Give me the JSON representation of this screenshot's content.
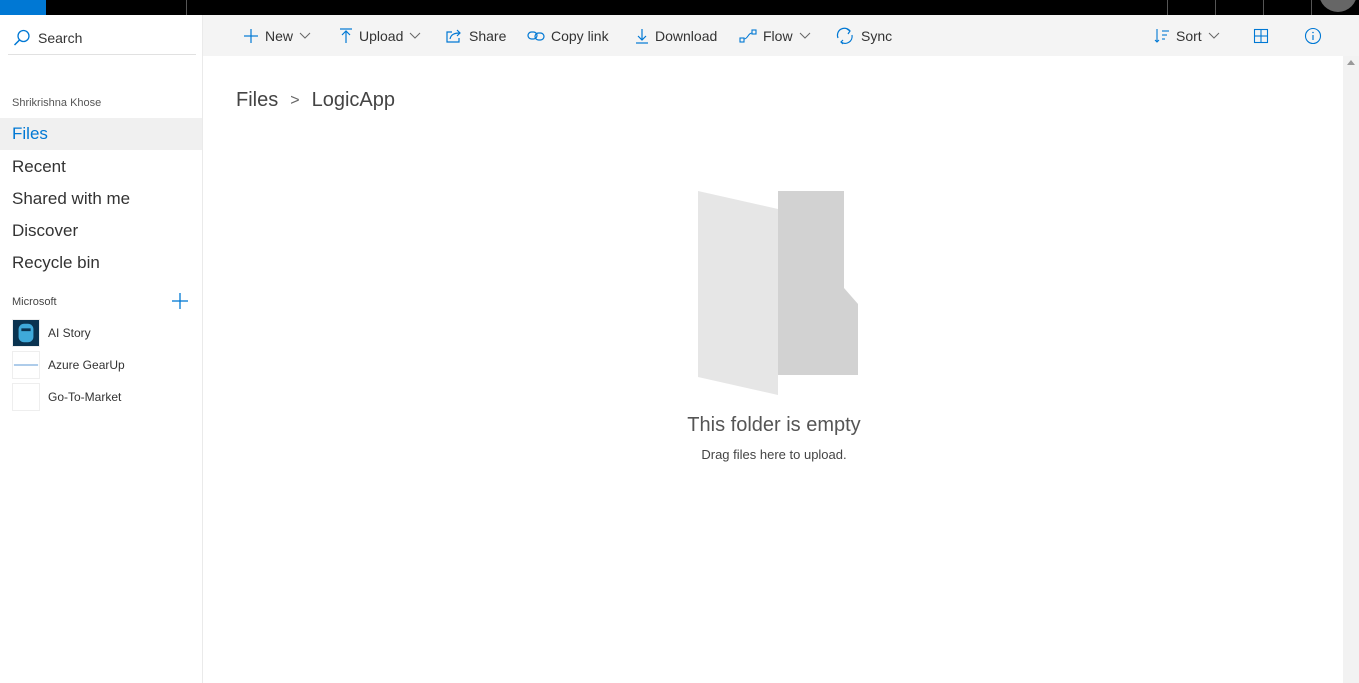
{
  "suitebar": {
    "accent": "#0078d4"
  },
  "leftnav": {
    "search_label": "Search",
    "user_name": "Shrikrishna Khose",
    "items": [
      {
        "label": "Files",
        "active": true
      },
      {
        "label": "Recent",
        "active": false
      },
      {
        "label": "Shared with me",
        "active": false
      },
      {
        "label": "Discover",
        "active": false
      },
      {
        "label": "Recycle bin",
        "active": false
      }
    ],
    "group_label": "Microsoft",
    "sites": [
      {
        "label": "AI Story",
        "icon": "ai-story-thumbnail"
      },
      {
        "label": "Azure GearUp",
        "icon": "azure-gearup-thumbnail"
      },
      {
        "label": "Go-To-Market",
        "icon": "go-to-market-thumbnail"
      }
    ]
  },
  "commandbar": {
    "new": "New",
    "upload": "Upload",
    "share": "Share",
    "copy_link": "Copy link",
    "download": "Download",
    "flow": "Flow",
    "sync": "Sync",
    "sort": "Sort"
  },
  "breadcrumb": {
    "root": "Files",
    "separator": ">",
    "current": "LogicApp"
  },
  "empty_state": {
    "title": "This folder is empty",
    "subtitle": "Drag files here to upload."
  }
}
